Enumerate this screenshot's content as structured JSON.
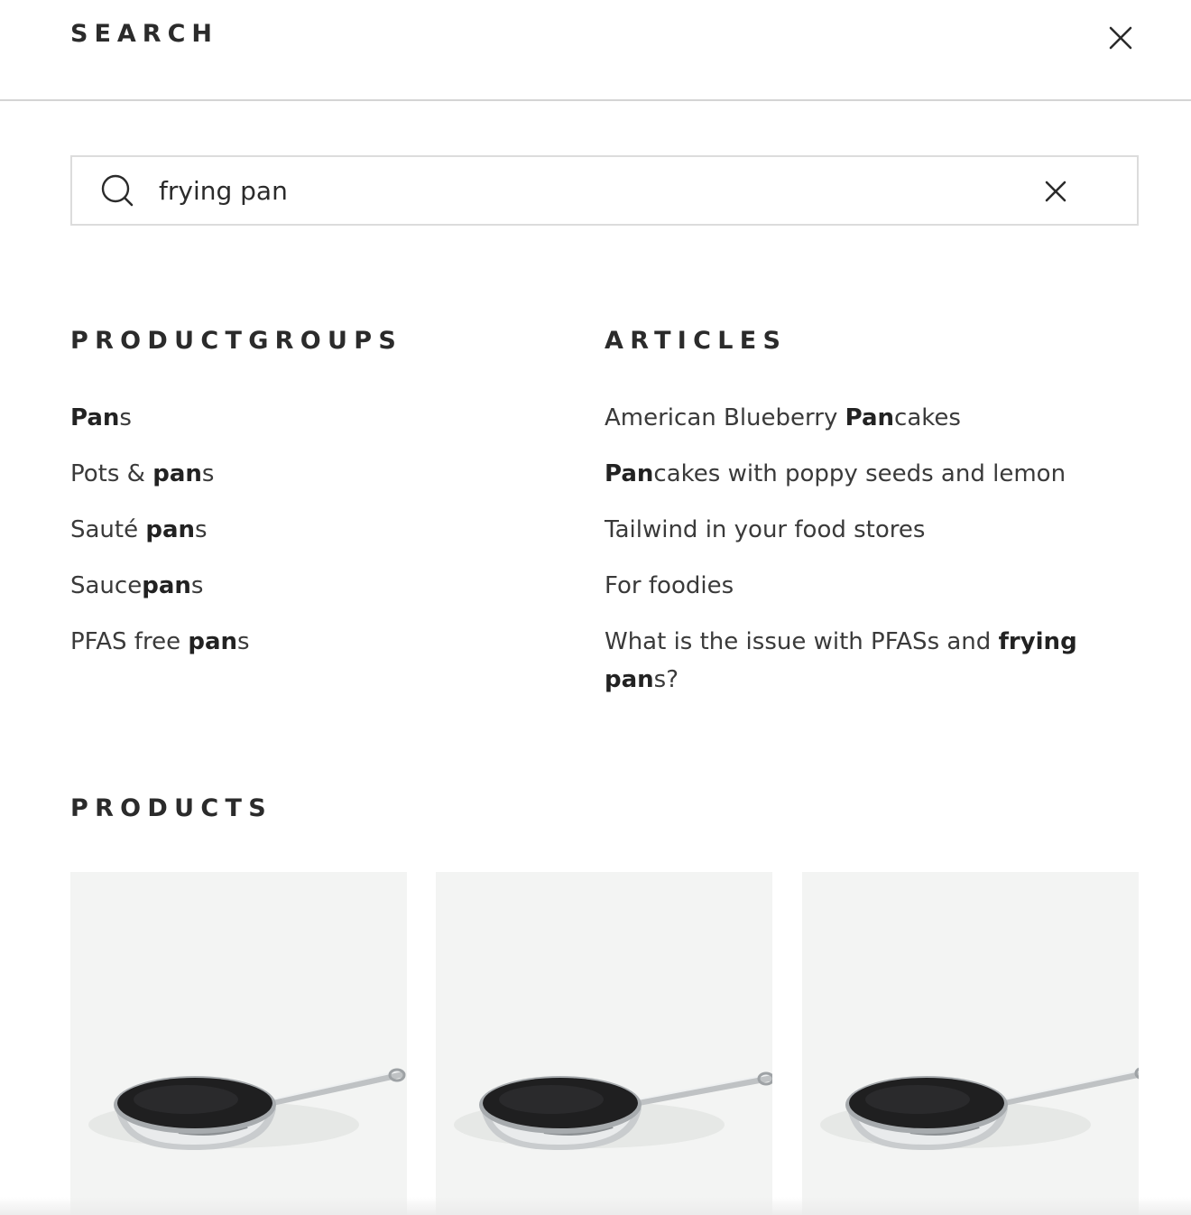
{
  "header": {
    "title": "SEARCH",
    "close_icon": "close-icon"
  },
  "search": {
    "query": "frying pan",
    "search_icon": "search-icon",
    "clear_icon": "clear-icon"
  },
  "productgroups": {
    "heading": "PRODUCTGROUPS",
    "items": [
      {
        "parts": [
          {
            "text": "Pan",
            "bold": true
          },
          {
            "text": "s",
            "bold": false
          }
        ]
      },
      {
        "parts": [
          {
            "text": "Pots & ",
            "bold": false
          },
          {
            "text": "pan",
            "bold": true
          },
          {
            "text": "s",
            "bold": false
          }
        ]
      },
      {
        "parts": [
          {
            "text": "Sauté ",
            "bold": false
          },
          {
            "text": "pan",
            "bold": true
          },
          {
            "text": "s",
            "bold": false
          }
        ]
      },
      {
        "parts": [
          {
            "text": "Sauce",
            "bold": false
          },
          {
            "text": "pan",
            "bold": true
          },
          {
            "text": "s",
            "bold": false
          }
        ]
      },
      {
        "parts": [
          {
            "text": "PFAS free ",
            "bold": false
          },
          {
            "text": "pan",
            "bold": true
          },
          {
            "text": "s",
            "bold": false
          }
        ]
      }
    ]
  },
  "articles": {
    "heading": "ARTICLES",
    "items": [
      {
        "parts": [
          {
            "text": "American Blueberry ",
            "bold": false
          },
          {
            "text": "Pan",
            "bold": true
          },
          {
            "text": "cakes",
            "bold": false
          }
        ]
      },
      {
        "parts": [
          {
            "text": "Pan",
            "bold": true
          },
          {
            "text": "cakes with poppy seeds and lemon",
            "bold": false
          }
        ]
      },
      {
        "parts": [
          {
            "text": "Tailwind in your food stores",
            "bold": false
          }
        ]
      },
      {
        "parts": [
          {
            "text": "For foodies",
            "bold": false
          }
        ]
      },
      {
        "parts": [
          {
            "text": "What is the issue with PFASs and ",
            "bold": false
          },
          {
            "text": "frying pan",
            "bold": true
          },
          {
            "text": "s?",
            "bold": false
          }
        ],
        "wrap": true
      }
    ]
  },
  "products": {
    "heading": "PRODUCTS",
    "items": [
      {
        "image": "frying-pan-image"
      },
      {
        "image": "frying-pan-image"
      },
      {
        "image": "frying-pan-image"
      }
    ]
  }
}
